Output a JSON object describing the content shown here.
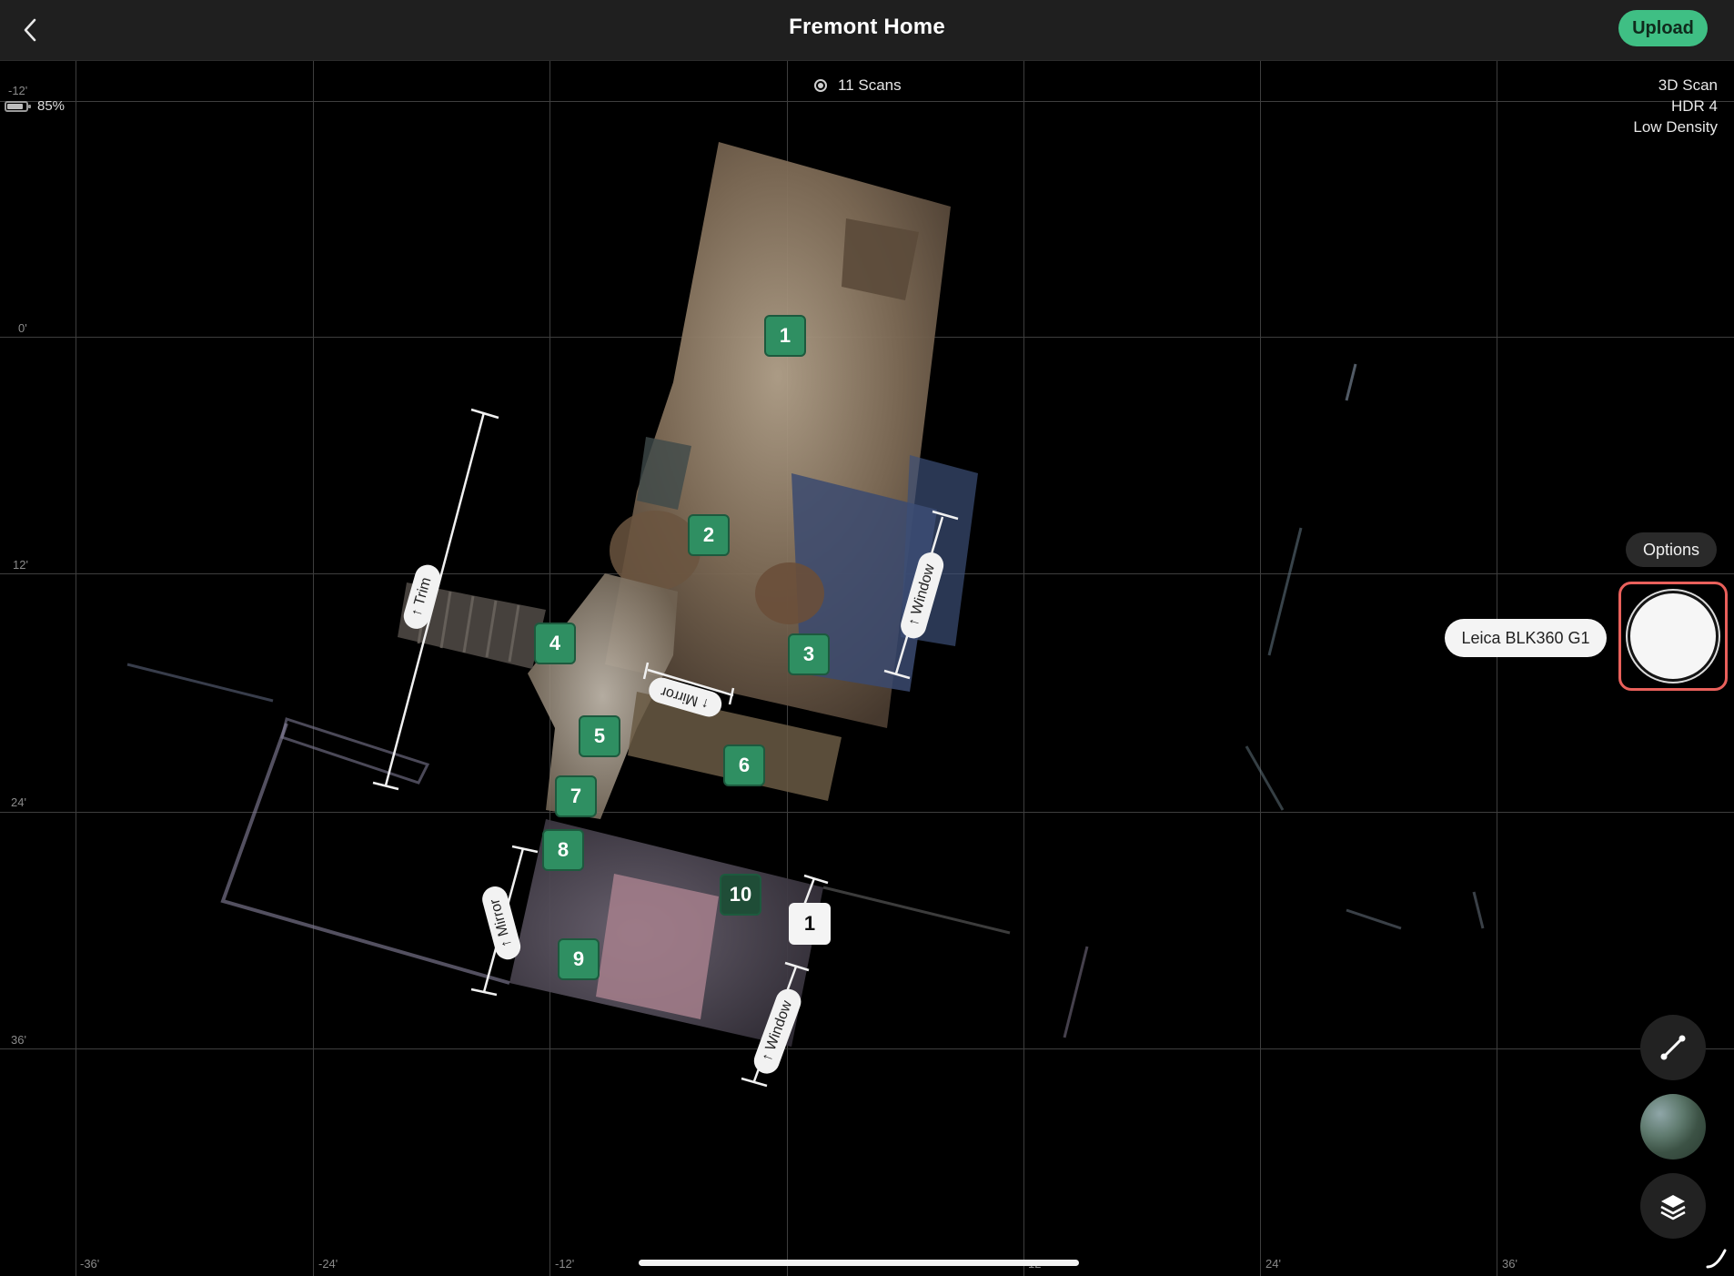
{
  "header": {
    "title": "Fremont Home",
    "upload_label": "Upload"
  },
  "status": {
    "battery_percent": "85%",
    "scan_count": "11 Scans"
  },
  "scan_settings": {
    "line1": "3D Scan",
    "line2": "HDR 4",
    "line3": "Low Density"
  },
  "grid": {
    "y_labels": [
      "-12'",
      "0'",
      "12'",
      "24'",
      "36'"
    ],
    "x_labels": [
      "-36'",
      "-24'",
      "-12'",
      "12'",
      "24'",
      "36'"
    ]
  },
  "scan_pins": [
    "1",
    "2",
    "3",
    "4",
    "5",
    "6",
    "7",
    "8",
    "9",
    "10"
  ],
  "measurements": {
    "trim": "↑ Trim",
    "window_top": "↑ Window",
    "mirror_top": "↑ Mirror",
    "mirror_bottom": "↑ Mirror",
    "window_bottom": "↑ Window"
  },
  "floor_marker": "1",
  "controls": {
    "options_label": "Options",
    "device_label": "Leica BLK360 G1"
  },
  "icons": {
    "back": "chevron-left-icon",
    "measure": "measure-line-icon",
    "layers": "layers-icon"
  },
  "colors": {
    "upload_green": "#3fbf84",
    "pin_green": "#2f8f62",
    "shutter_highlight": "#e9605b"
  }
}
